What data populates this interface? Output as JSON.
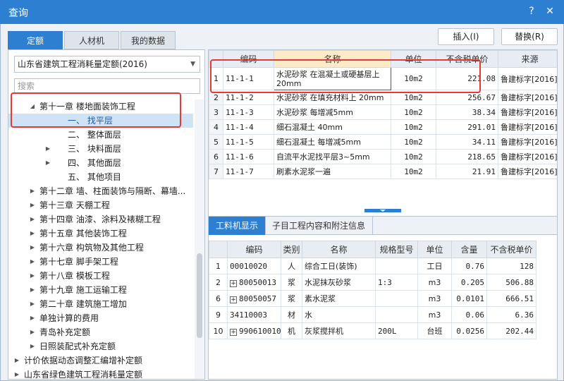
{
  "window": {
    "title": "查询",
    "help_glyph": "?",
    "close_glyph": "✕"
  },
  "tabs": [
    {
      "label": "定额",
      "active": true
    },
    {
      "label": "人材机",
      "active": false
    },
    {
      "label": "我的数据",
      "active": false
    }
  ],
  "toolbar": {
    "insert_label": "插入(I)",
    "replace_label": "替换(R)"
  },
  "left_panel": {
    "selected_norm": "山东省建筑工程消耗量定额(2016)",
    "search_placeholder": "搜索",
    "tree": [
      {
        "label": "第十一章 楼地面装饰工程",
        "arrow": "◢",
        "level": 1
      },
      {
        "label": "一、 找平层",
        "arrow": "",
        "level": 2,
        "selected": true
      },
      {
        "label": "二、 整体面层",
        "arrow": "",
        "level": 2
      },
      {
        "label": "三、 块料面层",
        "arrow": "▶",
        "level": 2
      },
      {
        "label": "四、 其他面层",
        "arrow": "▶",
        "level": 2
      },
      {
        "label": "五、 其他项目",
        "arrow": "",
        "level": 2
      },
      {
        "label": "第十二章 墙、柱面装饰与隔断、幕墙...",
        "arrow": "▶",
        "level": 1
      },
      {
        "label": "第十三章 天棚工程",
        "arrow": "▶",
        "level": 1
      },
      {
        "label": "第十四章 油漆、涂料及裱糊工程",
        "arrow": "▶",
        "level": 1
      },
      {
        "label": "第十五章 其他装饰工程",
        "arrow": "▶",
        "level": 1
      },
      {
        "label": "第十六章 构筑物及其他工程",
        "arrow": "▶",
        "level": 1
      },
      {
        "label": "第十七章 脚手架工程",
        "arrow": "▶",
        "level": 1
      },
      {
        "label": "第十八章 模板工程",
        "arrow": "▶",
        "level": 1
      },
      {
        "label": "第十九章 施工运输工程",
        "arrow": "▶",
        "level": 1
      },
      {
        "label": "第二十章 建筑施工增加",
        "arrow": "▶",
        "level": 1
      },
      {
        "label": "单独计算的费用",
        "arrow": "▶",
        "level": 1
      },
      {
        "label": "青岛补充定额",
        "arrow": "▶",
        "level": 1
      },
      {
        "label": "日照装配式补充定额",
        "arrow": "▶",
        "level": 1
      },
      {
        "label": "计价依据动态调整汇编增补定额",
        "arrow": "▶",
        "level": 0
      },
      {
        "label": "山东省绿色建筑工程消耗量定额",
        "arrow": "▶",
        "level": 0
      }
    ]
  },
  "quota_table": {
    "headers": [
      "",
      "编码",
      "名称",
      "单位",
      "不含税单价",
      "来源"
    ],
    "rows": [
      {
        "idx": "1",
        "code": "11-1-1",
        "name": "水泥砂浆 在混凝土或硬基层上 20mm",
        "unit": "10m2",
        "price": "221.08",
        "source": "鲁建标字[2016]"
      },
      {
        "idx": "2",
        "code": "11-1-2",
        "name": "水泥砂浆 在填充材料上 20mm",
        "unit": "10m2",
        "price": "256.67",
        "source": "鲁建标字[2016]"
      },
      {
        "idx": "3",
        "code": "11-1-3",
        "name": "水泥砂浆 每增减5mm",
        "unit": "10m2",
        "price": "38.34",
        "source": "鲁建标字[2016]"
      },
      {
        "idx": "4",
        "code": "11-1-4",
        "name": "细石混凝土 40mm",
        "unit": "10m2",
        "price": "291.01",
        "source": "鲁建标字[2016]"
      },
      {
        "idx": "5",
        "code": "11-1-5",
        "name": "细石混凝土 每增减5mm",
        "unit": "10m2",
        "price": "34.11",
        "source": "鲁建标字[2016]"
      },
      {
        "idx": "6",
        "code": "11-1-6",
        "name": "自流平水泥找平层3~5mm",
        "unit": "10m2",
        "price": "218.65",
        "source": "鲁建标字[2016]"
      },
      {
        "idx": "7",
        "code": "11-1-7",
        "name": "刷素水泥浆一遍",
        "unit": "10m2",
        "price": "21.91",
        "source": "鲁建标字[2016]"
      }
    ]
  },
  "sub_tabs": [
    {
      "label": "工料机显示",
      "active": true
    },
    {
      "label": "子目工程内容和附注信息",
      "active": false
    }
  ],
  "material_table": {
    "headers": [
      "",
      "编码",
      "类别",
      "名称",
      "规格型号",
      "单位",
      "含量",
      "不含税单价"
    ],
    "rows": [
      {
        "idx": "1",
        "code": "00010020",
        "plus": false,
        "cat": "人",
        "name": "综合工日(装饰)",
        "spec": "",
        "unit": "工日",
        "qty": "0.76",
        "price": "128"
      },
      {
        "idx": "2",
        "code": "80050013",
        "plus": true,
        "cat": "浆",
        "name": "水泥抹灰砂浆",
        "spec": "1:3",
        "unit": "m3",
        "qty": "0.205",
        "price": "506.88"
      },
      {
        "idx": "6",
        "code": "80050057",
        "plus": true,
        "cat": "浆",
        "name": "素水泥浆",
        "spec": "",
        "unit": "m3",
        "qty": "0.0101",
        "price": "666.51"
      },
      {
        "idx": "9",
        "code": "34110003",
        "plus": false,
        "cat": "材",
        "name": "水",
        "spec": "",
        "unit": "m3",
        "qty": "0.06",
        "price": "6.36"
      },
      {
        "idx": "10",
        "code": "990610010",
        "plus": true,
        "cat": "机",
        "name": "灰浆搅拌机",
        "spec": "200L",
        "unit": "台班",
        "qty": "0.0256",
        "price": "202.44"
      }
    ]
  },
  "colors": {
    "accent": "#2d7fd1",
    "highlight_box": "#e53935",
    "name_header": "#fdebc8"
  }
}
